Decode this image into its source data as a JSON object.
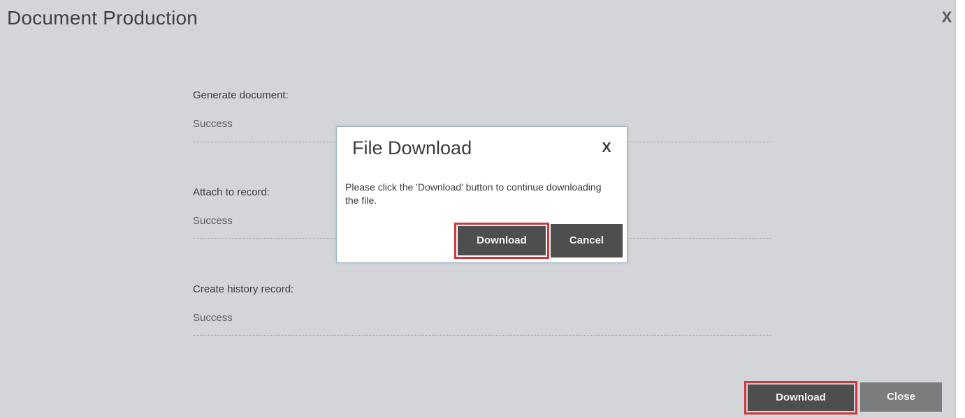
{
  "dialog": {
    "title": "Document Production",
    "close_glyph": "X",
    "close_icon": "close-icon"
  },
  "sections": [
    {
      "label": "Generate document:",
      "value": "Success"
    },
    {
      "label": "Attach to record:",
      "value": "Success"
    },
    {
      "label": "Create history record:",
      "value": "Success"
    }
  ],
  "footer": {
    "download_label": "Download",
    "close_label": "Close"
  },
  "modal": {
    "title": "File Download",
    "close_glyph": "X",
    "close_icon": "close-icon",
    "message": "Please click the 'Download' button to continue downloading the file.",
    "download_label": "Download",
    "cancel_label": "Cancel"
  },
  "colors": {
    "dialog_background": "#d4d5d8",
    "button_dark": "#4e4e4f",
    "button_grey": "#7b7c7e",
    "highlight_border": "#d3363a",
    "modal_border": "#9ab0c4"
  }
}
